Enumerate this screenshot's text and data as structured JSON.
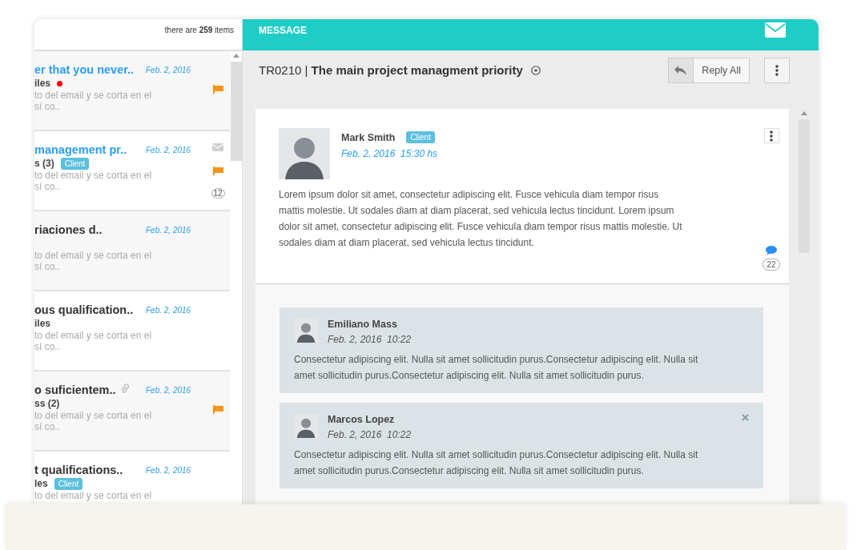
{
  "list": {
    "count_text": "there are **259** items",
    "items": [
      {
        "subject": "er that you never..",
        "unread": true,
        "date": "Feb. 2, 2016",
        "sender": "iles",
        "new_dot": true,
        "flagged": true,
        "mail": false,
        "attachment": false,
        "preview": [
          "to del email y se corta en el",
          "sí co.."
        ]
      },
      {
        "subject": "management pr..",
        "unread": true,
        "date": "Feb. 2, 2016",
        "sender": "s (3)",
        "badge": "Client",
        "new_dot": false,
        "flagged": true,
        "mail": true,
        "count": "12",
        "attachment": false,
        "preview": [
          "to del email y se corta en el",
          "sí co.."
        ]
      },
      {
        "subject": "riaciones d..",
        "unread": false,
        "date": "Feb. 2, 2016",
        "new_dot": false,
        "flagged": false,
        "mail": false,
        "attachment": false,
        "preview": [
          "to del email y se corta en el",
          "sí co.."
        ]
      },
      {
        "subject": "ous qualification..",
        "unread": false,
        "date": "Feb. 2, 2016",
        "sender": "iles",
        "new_dot": false,
        "flagged": false,
        "mail": false,
        "attachment": false,
        "preview": [
          "to del email y se corta en el",
          "sí co.."
        ]
      },
      {
        "subject": "o suficientem..",
        "unread": false,
        "date": "Feb. 2, 2016",
        "sender": "ss (2)",
        "new_dot": false,
        "flagged": true,
        "mail": false,
        "attachment": true,
        "preview": [
          "to del email y se corta en el",
          "sí co.."
        ]
      },
      {
        "subject": "t qualifications..",
        "unread": false,
        "date": "Feb. 2, 2016",
        "sender": "les",
        "badge": "Client",
        "new_dot": false,
        "flagged": false,
        "mail": false,
        "attachment": false,
        "preview": [
          "to del email y se corta en el"
        ]
      }
    ]
  },
  "message_pane": {
    "header": "MESSAGE",
    "title": "TR0210 | **The main project managment priority**",
    "reply_button": "Reply All",
    "message": {
      "author": "Mark Smith",
      "badge": "Client",
      "datetime": "Feb. 2, 2016  15:30 hs",
      "body": "Lorem ipsum dolor sit amet, consectetur adipiscing elit. Fusce vehicula diam tempor risus mattis molestie. Ut sodales diam at diam placerat, sed vehicula lectus tincidunt. Lorem ipsum dolor sit amet, consectetur adipiscing elit. Fusce vehicula diam tempor risus mattis molestie. Ut sodales diam at diam placerat, sed vehicula lectus tincidunt.",
      "comments": "22"
    },
    "replies": [
      {
        "author": "Emiliano Mass",
        "datetime": "Feb. 2, 2016  10:22",
        "closable": false,
        "body": "Consectetur adipiscing elit. Nulla sit amet sollicitudin purus.Consectetur adipiscing elit. Nulla sit amet sollicitudin purus.Consectetur adipiscing elit. Nulla sit amet sollicitudin purus."
      },
      {
        "author": "Marcos Lopez",
        "datetime": "Feb. 2, 2016  10:22",
        "closable": true,
        "body": "Consectetur adipiscing elit. Nulla sit amet sollicitudin purus.Consectetur adipiscing elit. Nulla sit amet sollicitudin purus.Consectetur adipiscing elit. Nulla sit amet sollicitudin purus."
      }
    ]
  }
}
